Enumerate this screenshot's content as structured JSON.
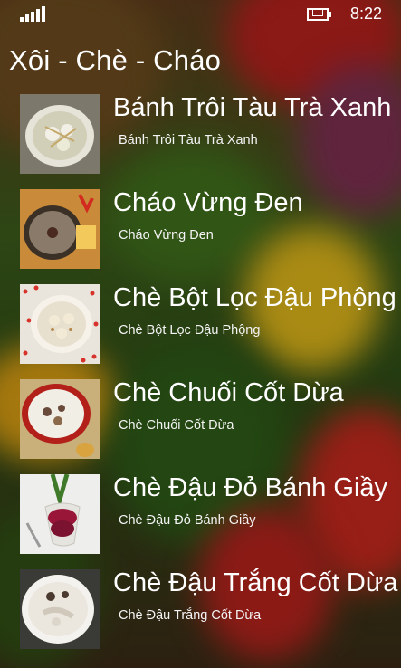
{
  "status_bar": {
    "time": "8:22",
    "signal_icon": "signal-strength-icon",
    "battery_icon": "battery-charging-icon"
  },
  "app": {
    "title": "Xôi - Chè - Cháo",
    "background": "blurred-vegetables"
  },
  "recipes": [
    {
      "title": "Bánh Trôi Tàu Trà Xanh",
      "subtitle": "Bánh Trôi Tàu Trà Xanh",
      "thumbnail": "tea-dumpling-bowl"
    },
    {
      "title": "Cháo Vừng Đen",
      "subtitle": "Cháo Vừng Đen",
      "thumbnail": "black-sesame-porridge"
    },
    {
      "title": "Chè Bột Lọc Đậu Phộng",
      "subtitle": "Chè Bột Lọc Đậu Phộng",
      "thumbnail": "tapioca-peanut-dessert"
    },
    {
      "title": "Chè Chuối Cốt Dừa",
      "subtitle": "Chè Chuối Cốt Dừa",
      "thumbnail": "banana-coconut-dessert"
    },
    {
      "title": "Chè Đậu Đỏ Bánh Giầy",
      "subtitle": "Chè Đậu Đỏ Bánh Giầy",
      "thumbnail": "red-bean-dessert-glass"
    },
    {
      "title": "Chè Đậu Trắng Cốt Dừa",
      "subtitle": "Chè Đậu Trắng Cốt Dừa",
      "thumbnail": "white-bean-coconut-dessert"
    }
  ],
  "colors": {
    "text": "#ffffff"
  }
}
